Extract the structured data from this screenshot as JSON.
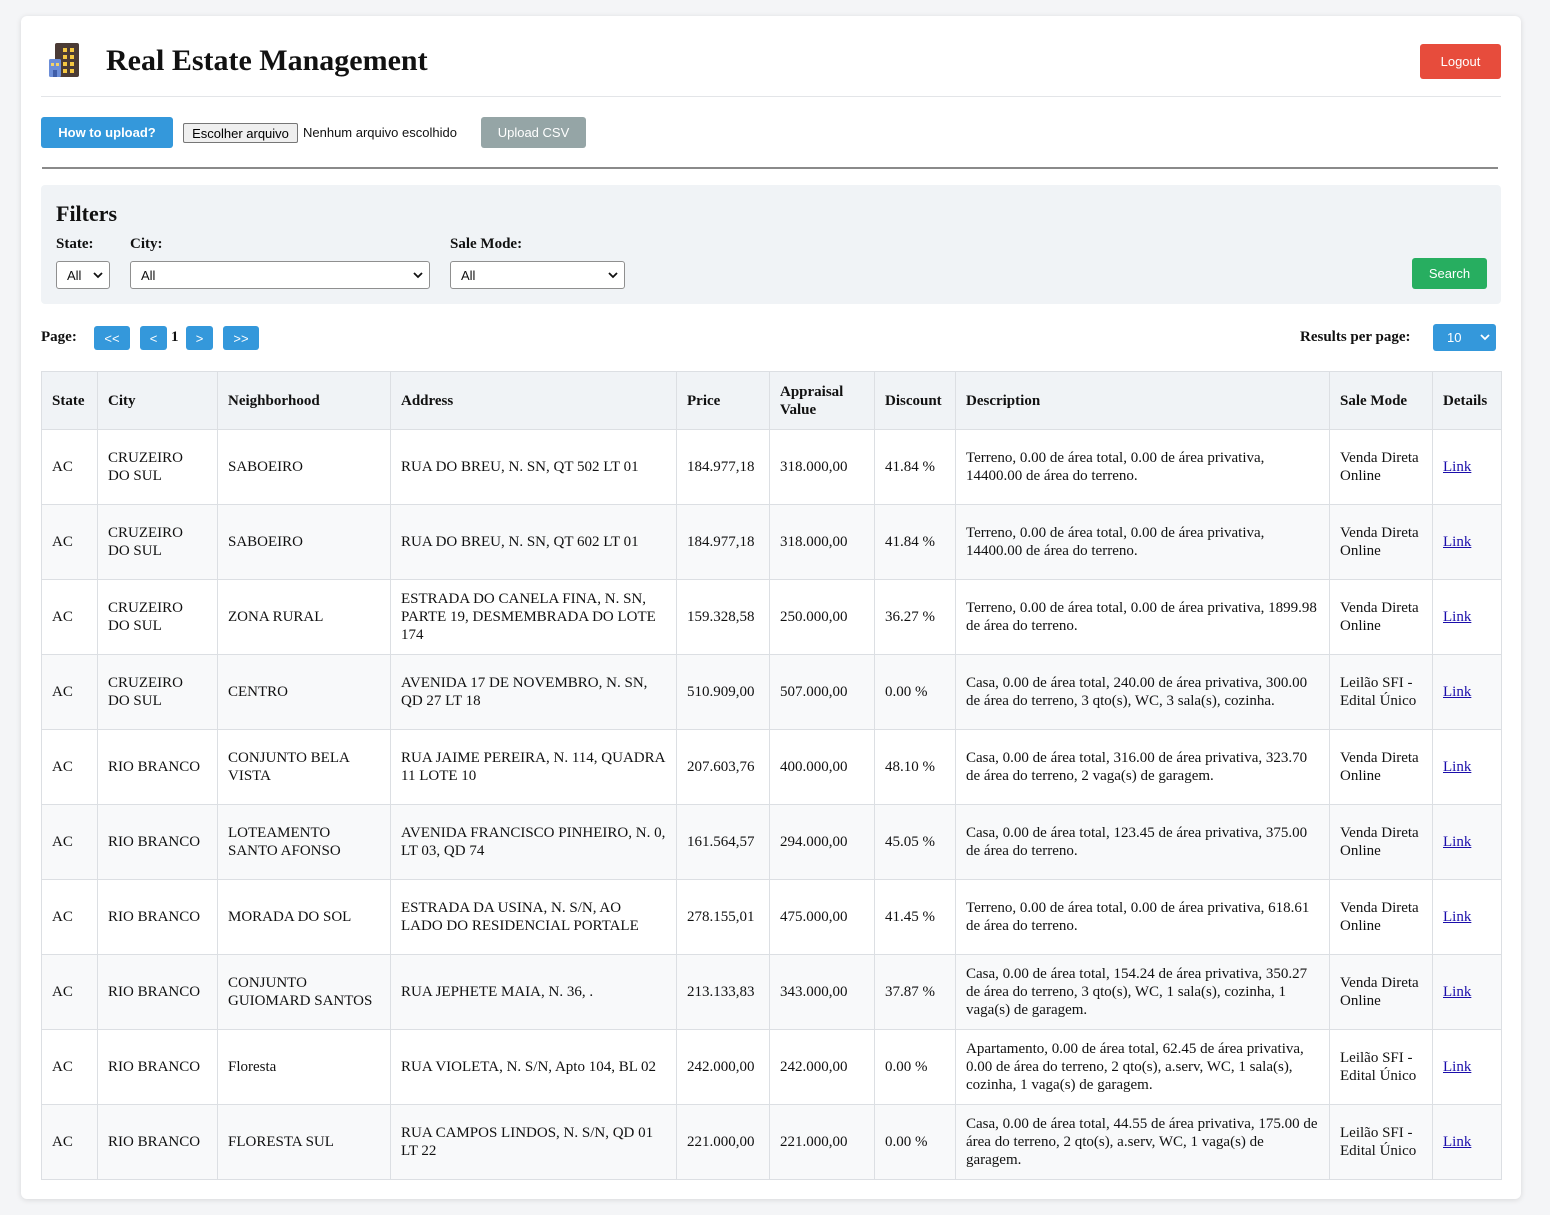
{
  "header": {
    "title": "Real Estate Management",
    "logout_label": "Logout"
  },
  "upload": {
    "howto_label": "How to upload?",
    "file_button_label": "Escolher arquivo",
    "file_status": "Nenhum arquivo escolhido",
    "upload_label": "Upload CSV"
  },
  "filters": {
    "title": "Filters",
    "state_label": "State:",
    "state_value": "All",
    "city_label": "City:",
    "city_value": "All",
    "sale_mode_label": "Sale Mode:",
    "sale_mode_value": "All",
    "search_label": "Search"
  },
  "pagination": {
    "page_label": "Page:",
    "first_label": "<<",
    "prev_label": "<",
    "current_page": "1",
    "next_label": ">",
    "last_label": ">>",
    "results_label": "Results per page:",
    "results_value": "10"
  },
  "table": {
    "columns": [
      "State",
      "City",
      "Neighborhood",
      "Address",
      "Price",
      "Appraisal Value",
      "Discount",
      "Description",
      "Sale Mode",
      "Details"
    ],
    "rows": [
      {
        "state": "AC",
        "city": "CRUZEIRO DO SUL",
        "neighborhood": "SABOEIRO",
        "address": "RUA DO BREU, N. SN, QT 502 LT 01",
        "price": "184.977,18",
        "appraisal": "318.000,00",
        "discount": "41.84 %",
        "description": "Terreno, 0.00 de área total, 0.00 de área privativa, 14400.00 de área do terreno.",
        "sale_mode": "Venda Direta Online",
        "details": "Link"
      },
      {
        "state": "AC",
        "city": "CRUZEIRO DO SUL",
        "neighborhood": "SABOEIRO",
        "address": "RUA DO BREU, N. SN, QT 602 LT 01",
        "price": "184.977,18",
        "appraisal": "318.000,00",
        "discount": "41.84 %",
        "description": "Terreno, 0.00 de área total, 0.00 de área privativa, 14400.00 de área do terreno.",
        "sale_mode": "Venda Direta Online",
        "details": "Link"
      },
      {
        "state": "AC",
        "city": "CRUZEIRO DO SUL",
        "neighborhood": "ZONA RURAL",
        "address": "ESTRADA DO CANELA FINA, N. SN, PARTE 19, DESMEMBRADA DO LOTE 174",
        "price": "159.328,58",
        "appraisal": "250.000,00",
        "discount": "36.27 %",
        "description": "Terreno, 0.00 de área total, 0.00 de área privativa, 1899.98 de área do terreno.",
        "sale_mode": "Venda Direta Online",
        "details": "Link"
      },
      {
        "state": "AC",
        "city": "CRUZEIRO DO SUL",
        "neighborhood": "CENTRO",
        "address": "AVENIDA 17 DE NOVEMBRO, N. SN, QD 27 LT 18",
        "price": "510.909,00",
        "appraisal": "507.000,00",
        "discount": "0.00 %",
        "description": "Casa, 0.00 de área total, 240.00 de área privativa, 300.00 de área do terreno, 3 qto(s), WC, 3 sala(s), cozinha.",
        "sale_mode": "Leilão SFI - Edital Único",
        "details": "Link"
      },
      {
        "state": "AC",
        "city": "RIO BRANCO",
        "neighborhood": "CONJUNTO BELA VISTA",
        "address": "RUA JAIME PEREIRA, N. 114, QUADRA 11 LOTE 10",
        "price": "207.603,76",
        "appraisal": "400.000,00",
        "discount": "48.10 %",
        "description": "Casa, 0.00 de área total, 316.00 de área privativa, 323.70 de área do terreno, 2 vaga(s) de garagem.",
        "sale_mode": "Venda Direta Online",
        "details": "Link"
      },
      {
        "state": "AC",
        "city": "RIO BRANCO",
        "neighborhood": "LOTEAMENTO SANTO AFONSO",
        "address": "AVENIDA FRANCISCO PINHEIRO, N. 0, LT 03, QD 74",
        "price": "161.564,57",
        "appraisal": "294.000,00",
        "discount": "45.05 %",
        "description": "Casa, 0.00 de área total, 123.45 de área privativa, 375.00 de área do terreno.",
        "sale_mode": "Venda Direta Online",
        "details": "Link"
      },
      {
        "state": "AC",
        "city": "RIO BRANCO",
        "neighborhood": "MORADA DO SOL",
        "address": "ESTRADA DA USINA, N. S/N, AO LADO DO RESIDENCIAL PORTALE",
        "price": "278.155,01",
        "appraisal": "475.000,00",
        "discount": "41.45 %",
        "description": "Terreno, 0.00 de área total, 0.00 de área privativa, 618.61 de área do terreno.",
        "sale_mode": "Venda Direta Online",
        "details": "Link"
      },
      {
        "state": "AC",
        "city": "RIO BRANCO",
        "neighborhood": "CONJUNTO GUIOMARD SANTOS",
        "address": "RUA JEPHETE MAIA, N. 36, .",
        "price": "213.133,83",
        "appraisal": "343.000,00",
        "discount": "37.87 %",
        "description": "Casa, 0.00 de área total, 154.24 de área privativa, 350.27 de área do terreno, 3 qto(s), WC, 1 sala(s), cozinha, 1 vaga(s) de garagem.",
        "sale_mode": "Venda Direta Online",
        "details": "Link"
      },
      {
        "state": "AC",
        "city": "RIO BRANCO",
        "neighborhood": "Floresta",
        "address": "RUA VIOLETA, N. S/N, Apto 104, BL 02",
        "price": "242.000,00",
        "appraisal": "242.000,00",
        "discount": "0.00 %",
        "description": "Apartamento, 0.00 de área total, 62.45 de área privativa, 0.00 de área do terreno, 2 qto(s), a.serv, WC, 1 sala(s), cozinha, 1 vaga(s) de garagem.",
        "sale_mode": "Leilão SFI - Edital Único",
        "details": "Link"
      },
      {
        "state": "AC",
        "city": "RIO BRANCO",
        "neighborhood": "FLORESTA SUL",
        "address": "RUA CAMPOS LINDOS, N. S/N, QD 01 LT 22",
        "price": "221.000,00",
        "appraisal": "221.000,00",
        "discount": "0.00 %",
        "description": "Casa, 0.00 de área total, 44.55 de área privativa, 175.00 de área do terreno, 2 qto(s), a.serv, WC, 1 vaga(s) de garagem.",
        "sale_mode": "Leilão SFI - Edital Único",
        "details": "Link"
      }
    ]
  },
  "icons": {
    "logo": "building-icon",
    "dropdown": "chevron-down-icon"
  },
  "colors": {
    "logout": "#e74c3c",
    "primary": "#3498db",
    "upload_disabled": "#95a5a6",
    "search": "#27ae60"
  }
}
